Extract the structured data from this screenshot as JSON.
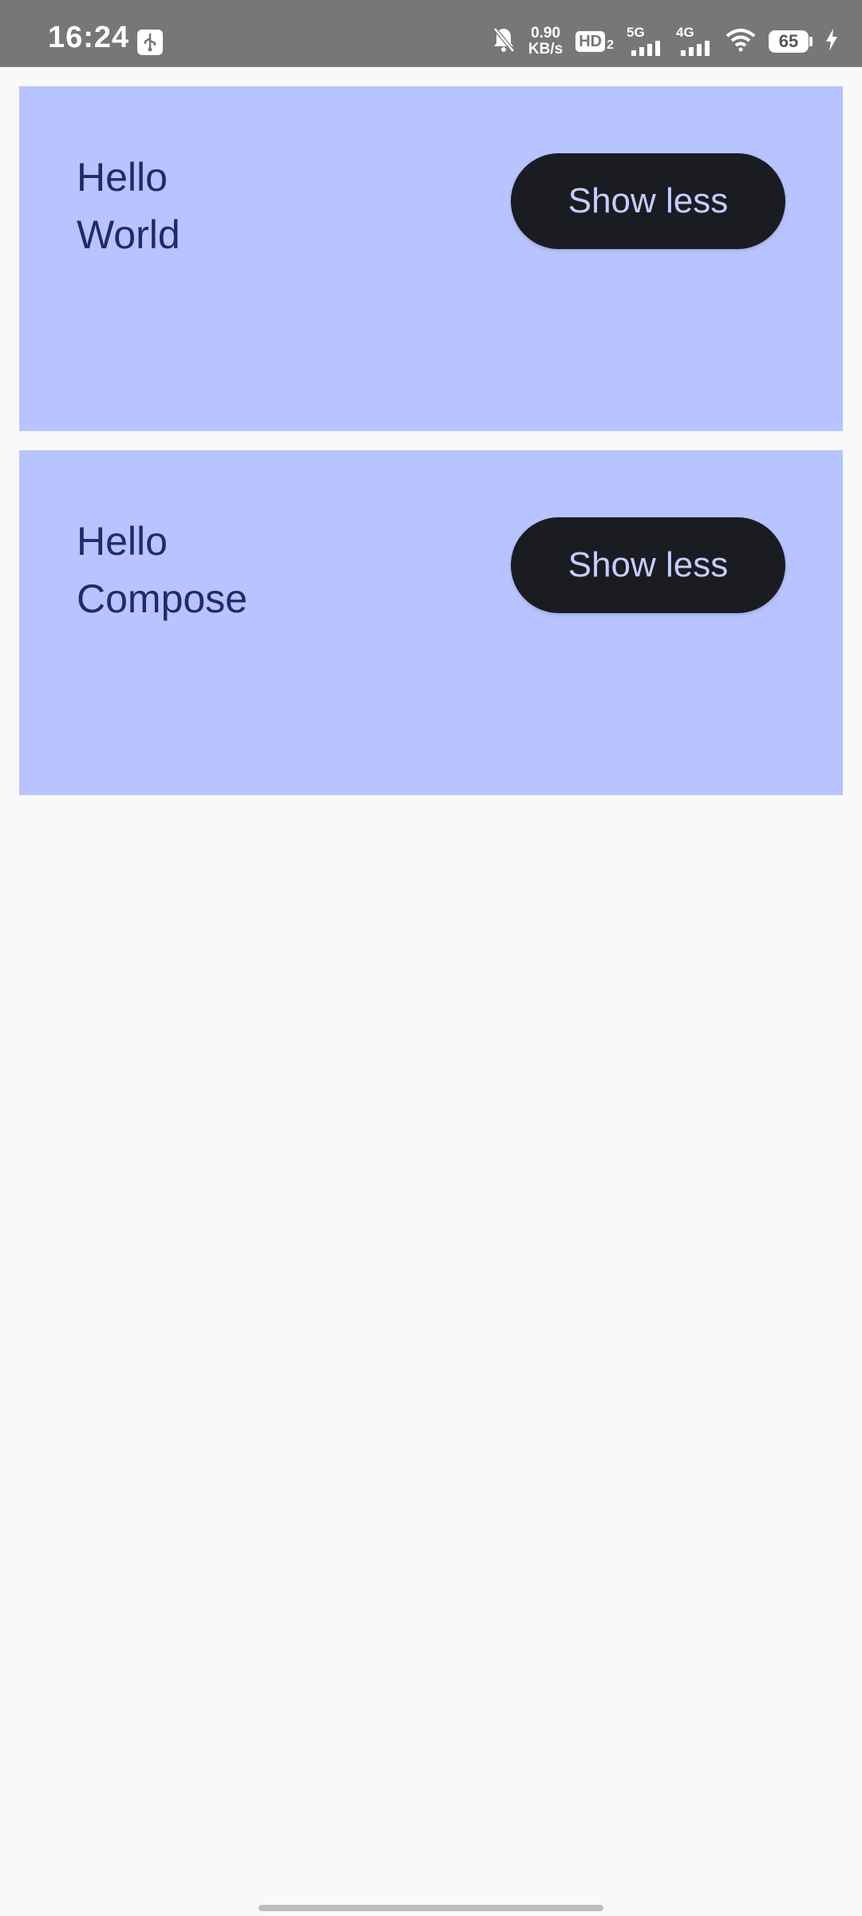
{
  "status_bar": {
    "time": "16:24",
    "net_speed_value": "0.90",
    "net_speed_unit": "KB/s",
    "hd_label": "HD",
    "hd_sub": "2",
    "sim1_label": "5G",
    "sim2_label": "4G",
    "battery_level": "65",
    "icons": [
      "usb-debug-icon",
      "bell-muted-icon",
      "hd-icon",
      "signal-5g-icon",
      "signal-4g-icon",
      "wifi-icon",
      "battery-icon",
      "charging-icon"
    ]
  },
  "cards": [
    {
      "greeting": "Hello",
      "name": "World",
      "button_label": "Show less"
    },
    {
      "greeting": "Hello",
      "name": "Compose",
      "button_label": "Show less"
    }
  ],
  "colors": {
    "status_bar_bg": "#777777",
    "page_bg": "#f9f9f9",
    "card_bg": "#b7c4ff",
    "card_text": "#1f2c6b",
    "button_bg": "#1b1c22",
    "button_text": "#c5cdff"
  }
}
